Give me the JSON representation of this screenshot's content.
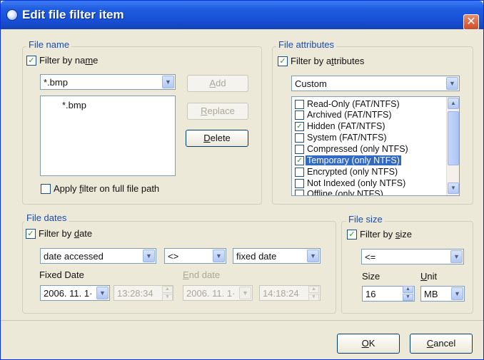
{
  "window": {
    "title": "Edit file filter item",
    "close_glyph": "✕"
  },
  "file_name": {
    "group_label": "File name",
    "filter_checkbox": {
      "label_pre": "Filter by na",
      "label_u": "m",
      "label_post": "e",
      "checked": true
    },
    "combo_value": "*.bmp",
    "list_items": [
      "*.bmp"
    ],
    "add_button": {
      "label_pre": "",
      "label_u": "A",
      "label_post": "dd"
    },
    "replace_button": {
      "label_pre": "",
      "label_u": "R",
      "label_post": "eplace"
    },
    "delete_button": {
      "label_pre": "",
      "label_u": "D",
      "label_post": "elete"
    },
    "full_path_checkbox": {
      "label_pre": "Apply ",
      "label_u": "f",
      "label_post": "ilter on full file path",
      "checked": false
    }
  },
  "file_attributes": {
    "group_label": "File attributes",
    "filter_checkbox": {
      "label_pre": "Filter by a",
      "label_u": "t",
      "label_post": "tributes",
      "checked": true
    },
    "preset_value": "Custom",
    "items": [
      {
        "label": "Read-Only (FAT/NTFS)",
        "checked": false,
        "selected": false
      },
      {
        "label": "Archived (FAT/NTFS)",
        "checked": false,
        "selected": false
      },
      {
        "label": "Hidden (FAT/NTFS)",
        "checked": true,
        "selected": false
      },
      {
        "label": "System (FAT/NTFS)",
        "checked": false,
        "selected": false
      },
      {
        "label": "Compressed (only NTFS)",
        "checked": false,
        "selected": false
      },
      {
        "label": "Temporary (only NTFS)",
        "checked": true,
        "selected": true
      },
      {
        "label": "Encrypted (only NTFS)",
        "checked": false,
        "selected": false
      },
      {
        "label": "Not Indexed (only NTFS)",
        "checked": false,
        "selected": false
      },
      {
        "label": "Offline (only NTFS)",
        "checked": false,
        "selected": false
      }
    ]
  },
  "file_dates": {
    "group_label": "File dates",
    "filter_checkbox": {
      "label_pre": "Filter by ",
      "label_u": "d",
      "label_post": "ate",
      "checked": true
    },
    "date_type": "date accessed",
    "operator": "<>",
    "mode": "fixed date",
    "fixed_date_label": "Fixed Date",
    "end_date_label_u": "E",
    "end_date_label_post": "nd date",
    "fixed_date_value": "2006. 11. 1·",
    "fixed_time_value": "13:28:34",
    "end_date_value": "2006. 11. 1·",
    "end_time_value": "14:18:24"
  },
  "file_size": {
    "group_label": "File size",
    "filter_checkbox": {
      "label_pre": "Filter by ",
      "label_u": "s",
      "label_post": "ize",
      "checked": true
    },
    "operator": "<=",
    "size_label": "Size",
    "unit_label_u": "U",
    "unit_label_post": "nit",
    "size_value": "16",
    "unit_value": "MB"
  },
  "footer": {
    "ok_button": {
      "label_pre": "",
      "label_u": "O",
      "label_post": "K"
    },
    "cancel_button": {
      "label_pre": "",
      "label_u": "C",
      "label_post": "ancel"
    }
  },
  "glyphs": {
    "check": "✓",
    "arrow_down": "▼",
    "arrow_up": "▲"
  }
}
